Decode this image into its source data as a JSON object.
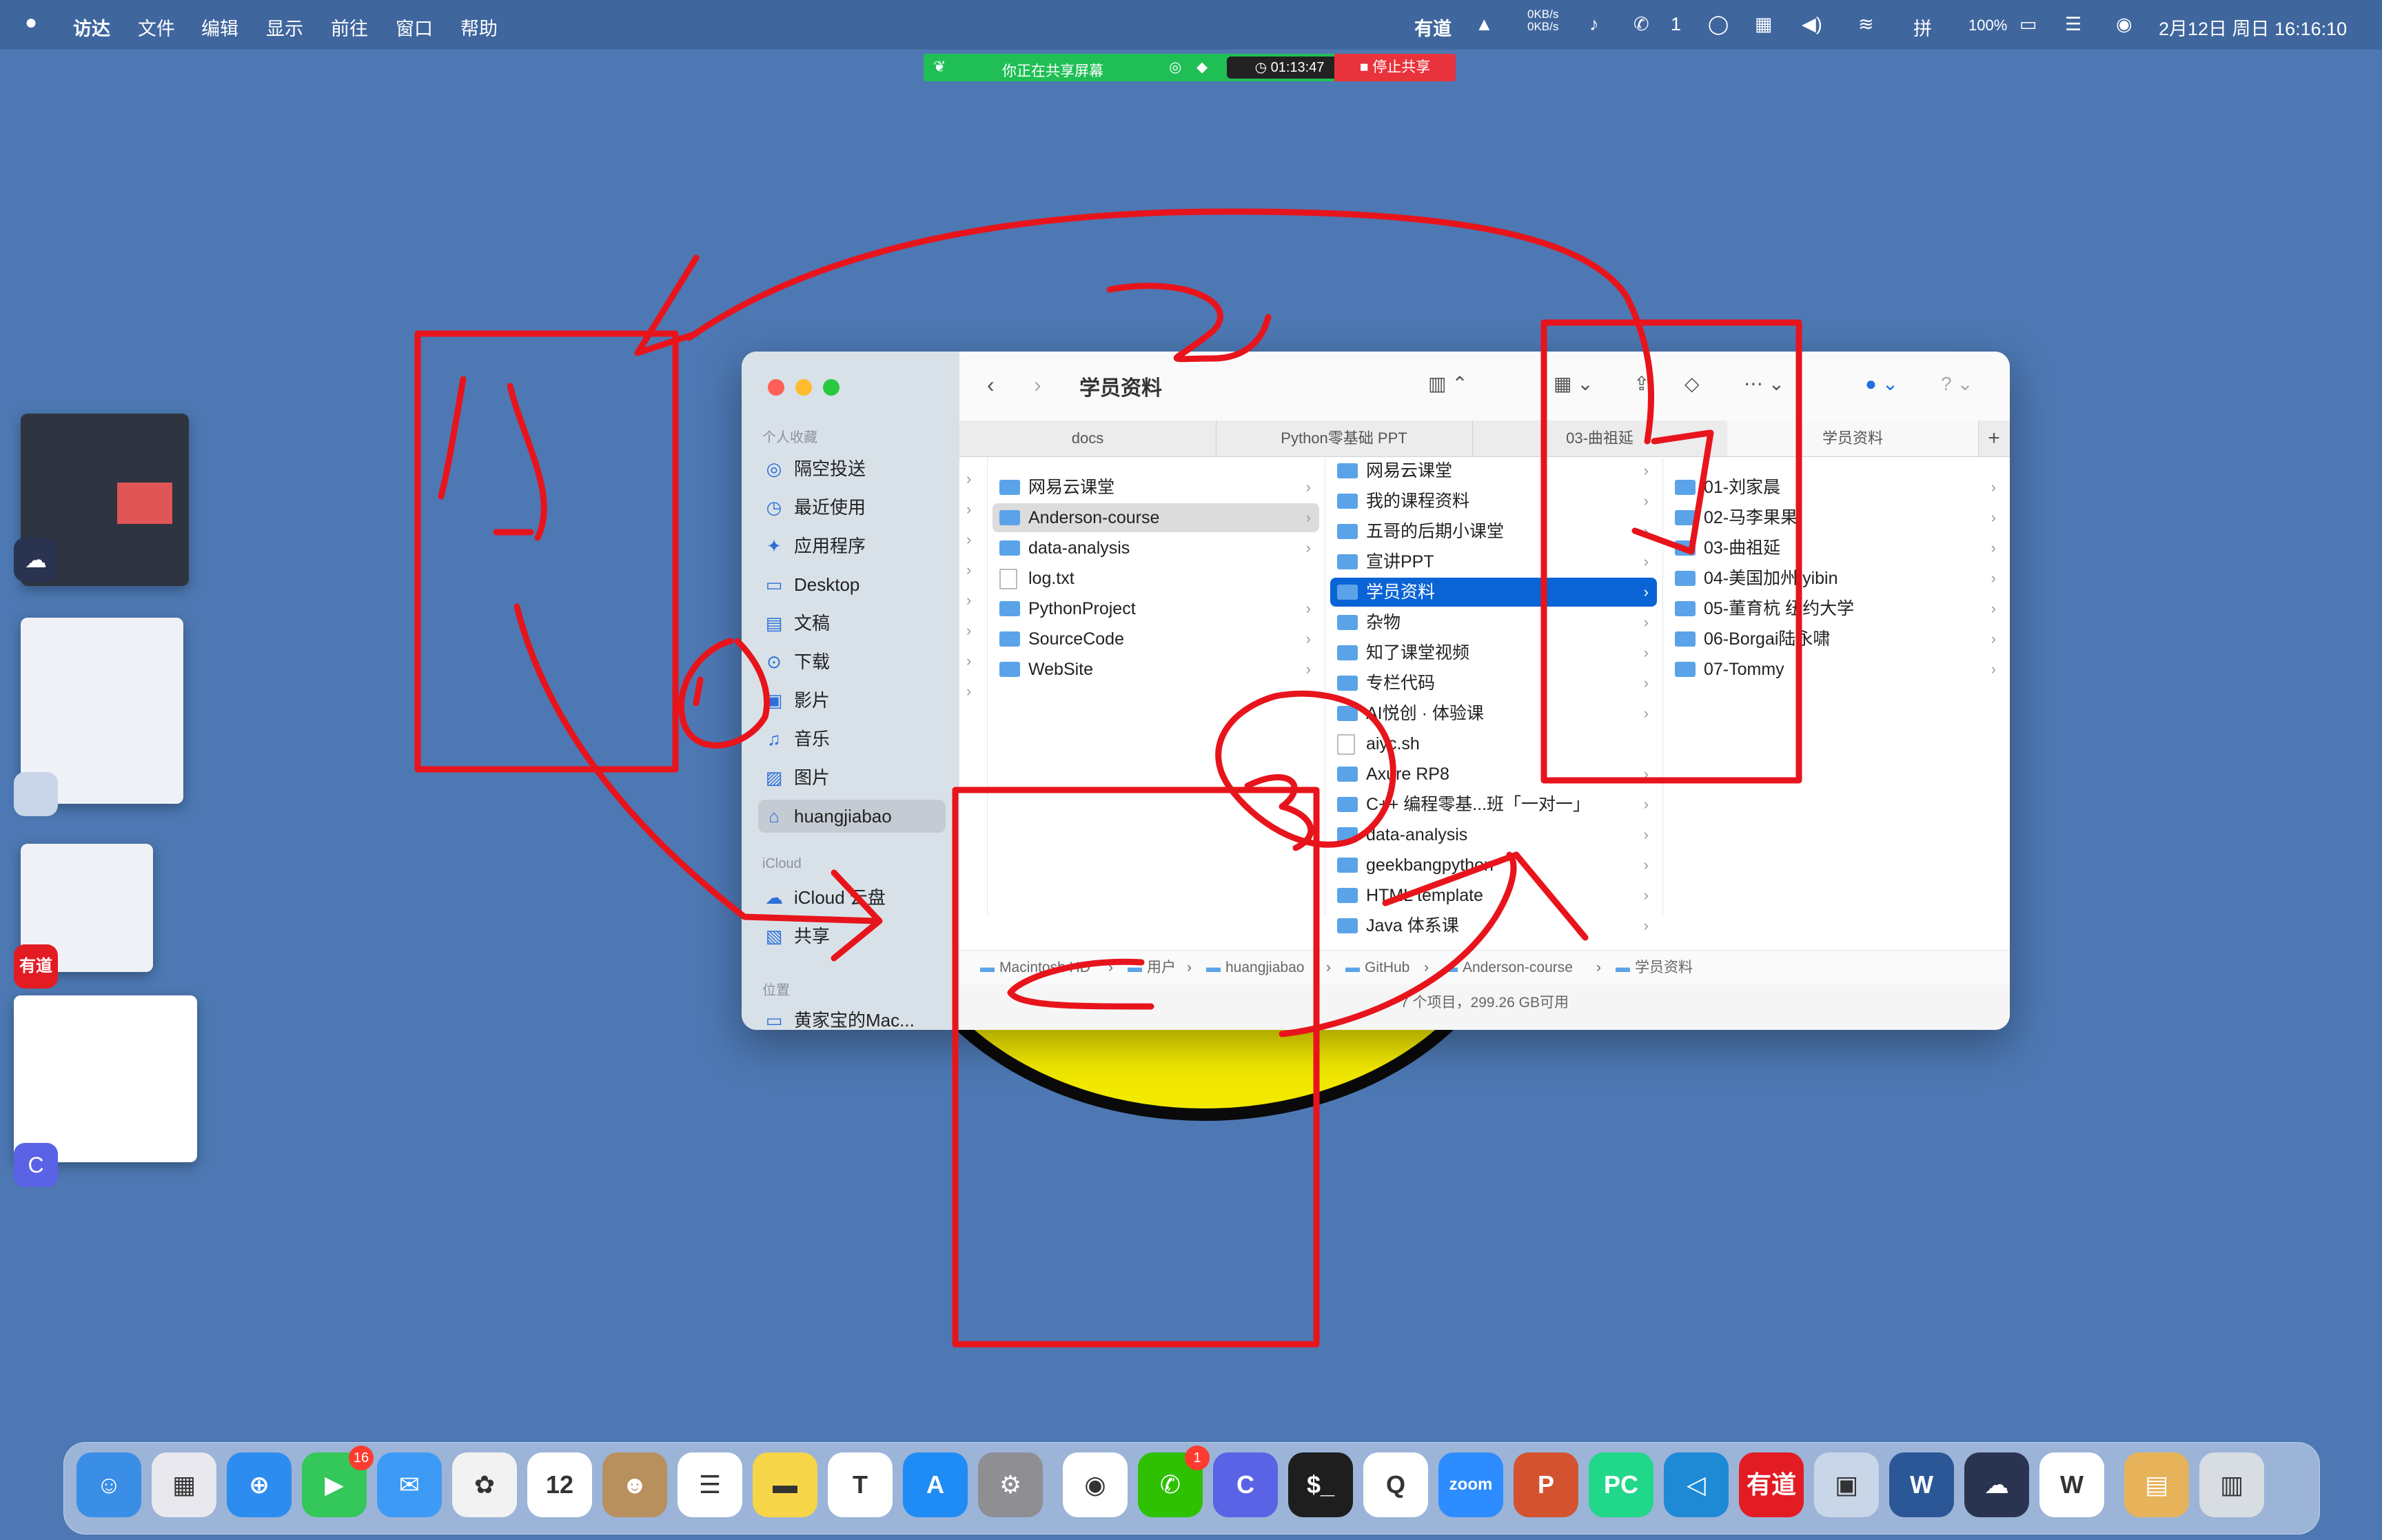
{
  "menubar": {
    "apple": "",
    "app": "访达",
    "menus": [
      "文件",
      "编辑",
      "显示",
      "前往",
      "窗口",
      "帮助"
    ],
    "youdao": "有道",
    "net_up": "0KB/s",
    "net_down": "0KB/s",
    "wechat_count": "1",
    "battery": "100%",
    "datetime": "2月12日 周日 16:16:10"
  },
  "share": {
    "label": "你正在共享屏幕",
    "timer": "01:13:47",
    "stop": "停止共享"
  },
  "sidebar": {
    "section_favorites": "个人收藏",
    "items": [
      {
        "icon": "airdrop-icon",
        "glyph": "◎",
        "label": "隔空投送"
      },
      {
        "icon": "recent-icon",
        "glyph": "◷",
        "label": "最近使用"
      },
      {
        "icon": "applications-icon",
        "glyph": "✦",
        "label": "应用程序"
      },
      {
        "icon": "desktop-icon",
        "glyph": "▭",
        "label": "Desktop"
      },
      {
        "icon": "documents-icon",
        "glyph": "▤",
        "label": "文稿"
      },
      {
        "icon": "downloads-icon",
        "glyph": "⊙",
        "label": "下载"
      },
      {
        "icon": "movies-icon",
        "glyph": "▣",
        "label": "影片"
      },
      {
        "icon": "music-icon",
        "glyph": "♫",
        "label": "音乐"
      },
      {
        "icon": "pictures-icon",
        "glyph": "▨",
        "label": "图片"
      },
      {
        "icon": "home-icon",
        "glyph": "⌂",
        "label": "huangjiabao"
      }
    ],
    "section_icloud": "iCloud",
    "icloud_items": [
      {
        "icon": "icloud-icon",
        "glyph": "☁",
        "label": "iCloud 云盘"
      },
      {
        "icon": "shared-icon",
        "glyph": "▧",
        "label": "共享"
      }
    ],
    "section_locations": "位置",
    "location_items": [
      {
        "icon": "mac-icon",
        "glyph": "▭",
        "label": "黄家宝的Mac..."
      }
    ]
  },
  "toolbar": {
    "title": "学员资料"
  },
  "tabs": [
    "docs",
    "Python零基础 PPT",
    "03-曲祖延",
    "学员资料"
  ],
  "columns": {
    "col2": [
      {
        "name": "网易云课堂",
        "type": "folder"
      },
      {
        "name": "Anderson-course",
        "type": "folder",
        "state": "gray"
      },
      {
        "name": "data-analysis",
        "type": "folder"
      },
      {
        "name": "log.txt",
        "type": "file"
      },
      {
        "name": "PythonProject",
        "type": "folder"
      },
      {
        "name": "SourceCode",
        "type": "folder"
      },
      {
        "name": "WebSite",
        "type": "folder"
      }
    ],
    "col3": [
      {
        "name": "网易云课堂",
        "type": "folder"
      },
      {
        "name": "我的课程资料",
        "type": "folder"
      },
      {
        "name": "五哥的后期小课堂",
        "type": "folder"
      },
      {
        "name": "宣讲PPT",
        "type": "folder"
      },
      {
        "name": "学员资料",
        "type": "folder",
        "state": "sel"
      },
      {
        "name": "杂物",
        "type": "folder"
      },
      {
        "name": "知了课堂视频",
        "type": "folder"
      },
      {
        "name": "专栏代码",
        "type": "folder"
      },
      {
        "name": "AI悦创 · 体验课",
        "type": "folder"
      },
      {
        "name": "aiyc.sh",
        "type": "file"
      },
      {
        "name": "Axure RP8",
        "type": "folder"
      },
      {
        "name": "C++ 编程零基...班「一对一」",
        "type": "folder"
      },
      {
        "name": "data-analysis",
        "type": "folder"
      },
      {
        "name": "geekbangpython",
        "type": "folder"
      },
      {
        "name": "HTML template",
        "type": "folder"
      },
      {
        "name": "Java 体系课",
        "type": "folder"
      }
    ],
    "col4": [
      {
        "name": "01-刘家晨",
        "type": "folder"
      },
      {
        "name": "02-马李果果",
        "type": "folder"
      },
      {
        "name": "03-曲祖延",
        "type": "folder"
      },
      {
        "name": "04-美国加州 yibin",
        "type": "folder"
      },
      {
        "name": "05-董育杭 纽约大学",
        "type": "folder"
      },
      {
        "name": "06-Borgai陆永啸",
        "type": "folder"
      },
      {
        "name": "07-Tommy",
        "type": "folder"
      }
    ]
  },
  "pathbar": [
    "Macintosh HD",
    "用户",
    "huangjiabao",
    "GitHub",
    "Anderson-course",
    "学员资料"
  ],
  "status": "7 个项目，299.26 GB可用",
  "annotations": {
    "labels": [
      "1",
      "2",
      "3"
    ]
  },
  "dock": [
    {
      "name": "finder",
      "label": "☺",
      "color": "#3a8ee6"
    },
    {
      "name": "launchpad",
      "label": "▦",
      "color": "#e8e8ee"
    },
    {
      "name": "safari",
      "label": "⊕",
      "color": "#2d8cf0"
    },
    {
      "name": "facetime",
      "label": "▶",
      "color": "#34c759",
      "badge": "16"
    },
    {
      "name": "mail",
      "label": "✉",
      "color": "#3d9bf5"
    },
    {
      "name": "photos",
      "label": "✿",
      "color": "#f2f2f2"
    },
    {
      "name": "calendar",
      "label": "12",
      "color": "#ffffff"
    },
    {
      "name": "contacts",
      "label": "☻",
      "color": "#b8905e"
    },
    {
      "name": "reminders",
      "label": "☰",
      "color": "#ffffff"
    },
    {
      "name": "notes",
      "label": "▬",
      "color": "#f7d548"
    },
    {
      "name": "typora",
      "label": "T",
      "color": "#ffffff"
    },
    {
      "name": "app-store",
      "label": "A",
      "color": "#1f8cf5"
    },
    {
      "name": "system-preferences",
      "label": "⚙",
      "color": "#8e8e93"
    },
    {
      "name": "chrome",
      "label": "◉",
      "color": "#ffffff"
    },
    {
      "name": "wechat",
      "label": "✆",
      "color": "#2dc100",
      "badge": "1"
    },
    {
      "name": "c-app",
      "label": "C",
      "color": "#5a62e6"
    },
    {
      "name": "terminal",
      "label": "$_",
      "color": "#1e1e1e"
    },
    {
      "name": "qq",
      "label": "Q",
      "color": "#ffffff"
    },
    {
      "name": "zoom",
      "label": "zoom",
      "color": "#2d8cff"
    },
    {
      "name": "powerpoint",
      "label": "P",
      "color": "#d35230"
    },
    {
      "name": "pycharm",
      "label": "PC",
      "color": "#21d789"
    },
    {
      "name": "vscode",
      "label": "◁",
      "color": "#1e8ad6"
    },
    {
      "name": "youdao",
      "label": "有道",
      "color": "#e31b23"
    },
    {
      "name": "preview",
      "label": "▣",
      "color": "#c9d6e8"
    },
    {
      "name": "word",
      "label": "W",
      "color": "#2b5797"
    },
    {
      "name": "shell-app",
      "label": "☁",
      "color": "#2a3450"
    },
    {
      "name": "wps",
      "label": "W",
      "color": "#ffffff"
    },
    {
      "name": "archive",
      "label": "▤",
      "color": "#e6b35a"
    },
    {
      "name": "trash",
      "label": "▥",
      "color": "#d8dde4"
    }
  ]
}
